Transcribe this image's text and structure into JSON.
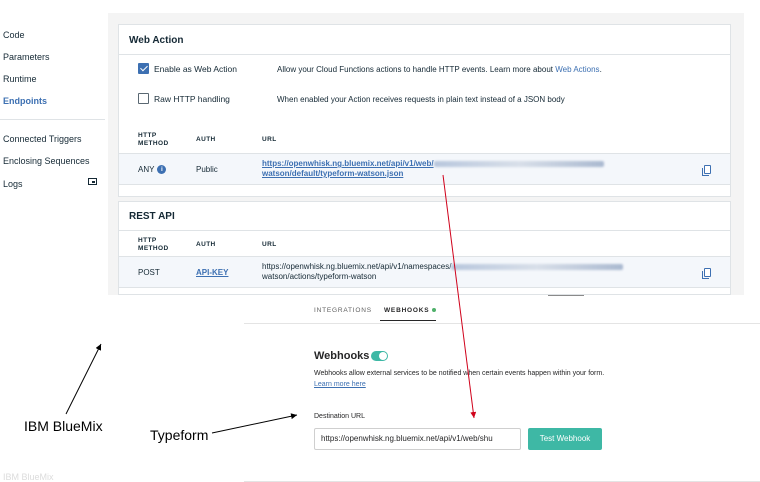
{
  "sidebar": {
    "items": [
      {
        "label": "Code"
      },
      {
        "label": "Parameters"
      },
      {
        "label": "Runtime"
      },
      {
        "label": "Endpoints"
      },
      {
        "label": "Connected Triggers"
      },
      {
        "label": "Enclosing Sequences"
      },
      {
        "label": "Logs"
      }
    ],
    "logs_icon": "external-window-icon",
    "ghost_text": "IBM BlueMix"
  },
  "web_action": {
    "title": "Web Action",
    "enable_label": "Enable as Web Action",
    "enable_checked": true,
    "enable_desc": "Allow your Cloud Functions actions to handle HTTP events. Learn more about",
    "enable_desc_link": "Web Actions",
    "enable_desc_end": ".",
    "raw_label": "Raw HTTP handling",
    "raw_checked": false,
    "raw_desc": "When enabled your Action receives requests in plain text instead of a JSON body",
    "headers": {
      "method_1": "HTTP",
      "method_2": "METHOD",
      "auth": "AUTH",
      "url": "URL"
    },
    "row": {
      "method": "ANY",
      "info_glyph": "i",
      "auth": "Public",
      "url_line1": "https://openwhisk.ng.bluemix.net/api/v1/web/",
      "url_line2": "watson/default/typeform-watson.json"
    }
  },
  "rest_api": {
    "title": "REST API",
    "headers": {
      "method_1": "HTTP",
      "method_2": "METHOD",
      "auth": "AUTH",
      "url": "URL"
    },
    "row": {
      "method": "POST",
      "auth": "API-KEY",
      "url_line1": "https://openwhisk.ng.bluemix.net/api/v1/namespaces/",
      "url_line2": "watson/actions/typeform-watson"
    }
  },
  "typeform": {
    "tabs": [
      {
        "label": "INTEGRATIONS",
        "active": false
      },
      {
        "label": "WEBHOOKS",
        "active": true
      }
    ],
    "heading": "Webhooks",
    "toggle_on": true,
    "description": "Webhooks allow external services to be notified when certain events happen within your form.",
    "learn_more": "Learn more here",
    "destination_label": "Destination URL",
    "destination_value": "https://openwhisk.ng.bluemix.net/api/v1/web/shu",
    "test_button": "Test Webhook"
  },
  "annotations": {
    "bluemix": "IBM BlueMix",
    "typeform": "Typeform"
  },
  "colors": {
    "ibm_blue": "#3d70b2",
    "typeform_teal": "#3eb8a5",
    "status_green": "#4fb06a",
    "arrow_red": "#d0021b",
    "panel_gray": "#f4f4f4"
  }
}
